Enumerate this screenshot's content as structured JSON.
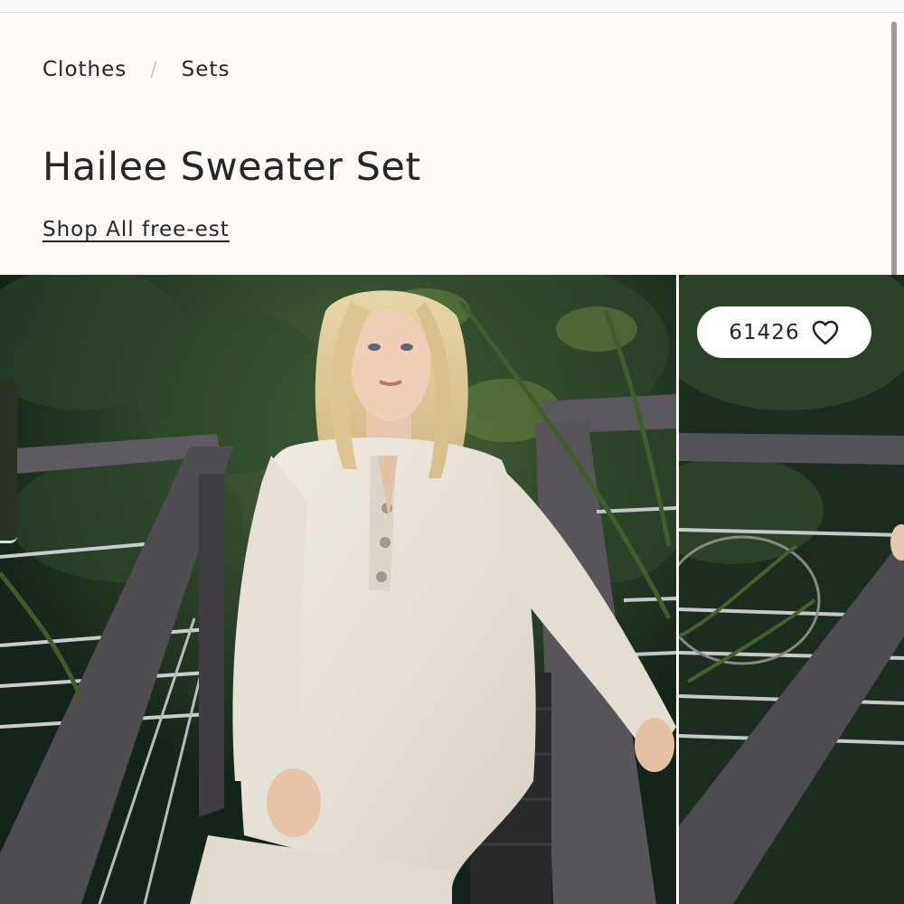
{
  "breadcrumb": {
    "items": [
      "Clothes",
      "Sets"
    ],
    "separator": "/"
  },
  "product": {
    "title": "Hailee Sweater Set",
    "shop_link": "Shop All free-est"
  },
  "gallery": {
    "like_count": "61426",
    "like_icon": "heart-outline-icon",
    "images": [
      "Model in cream knit henley sweater set leaning on wooden stair railing",
      "Partial view of next product image"
    ]
  },
  "colors": {
    "background": "#fdfaf8",
    "text": "#262626",
    "sweater": "#ece6dc",
    "foliage": "#1f3322"
  }
}
